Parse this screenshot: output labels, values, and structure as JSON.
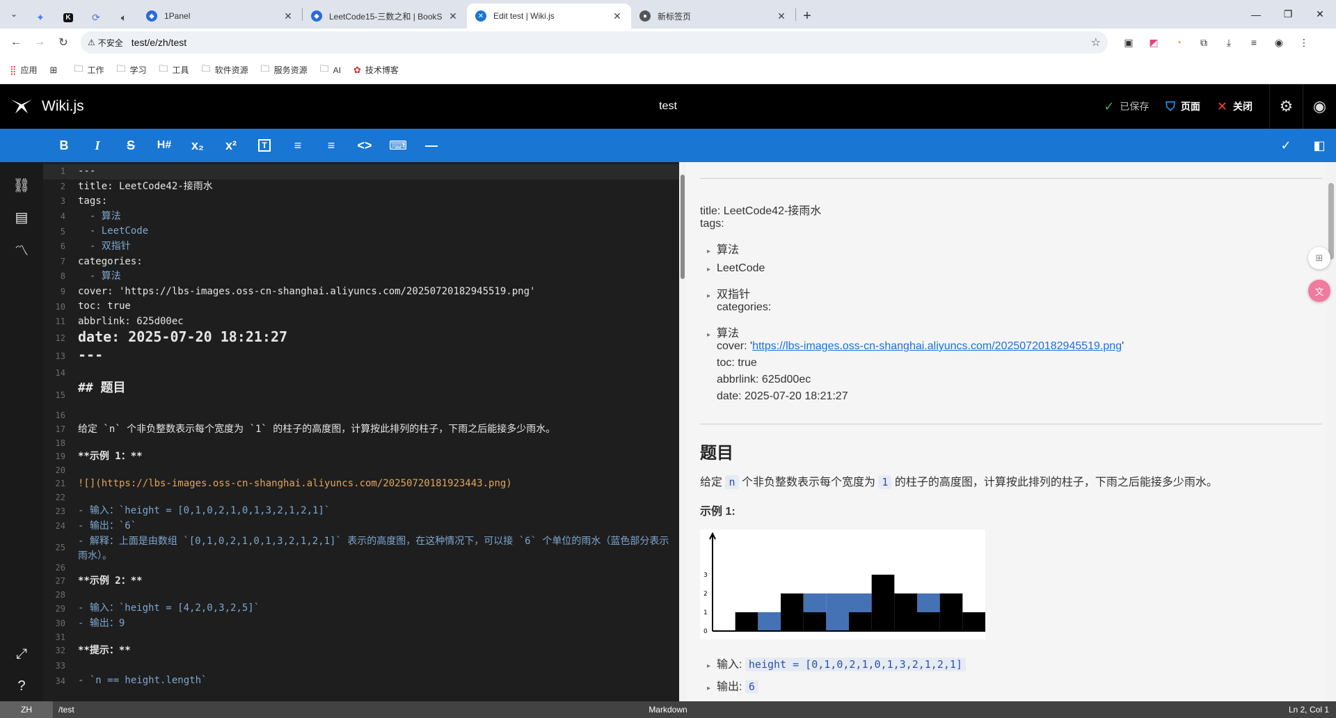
{
  "browser": {
    "tabs": [
      {
        "title": "1Panel",
        "active": false
      },
      {
        "title": "LeetCode15-三数之和 | BookS",
        "active": false
      },
      {
        "title": "Edit test | Wiki.js",
        "active": true
      },
      {
        "title": "新标签页",
        "active": false
      }
    ],
    "close_glyph": "✕",
    "new_tab_glyph": "+",
    "address": {
      "security_label": "不安全",
      "url": "test/e/zh/test"
    },
    "bookmarks": [
      "应用",
      "工作",
      "学习",
      "工具",
      "软件资源",
      "服务资源",
      "AI",
      "技术博客"
    ]
  },
  "app": {
    "brand": "Wiki.js",
    "page_title": "test",
    "actions": {
      "saved": "已保存",
      "page": "页面",
      "close": "关闭"
    }
  },
  "toolbar": {
    "icons": [
      "bold-icon",
      "italic-icon",
      "strikethrough-icon",
      "heading-icon",
      "subscript-icon",
      "superscript-icon",
      "blockquote-icon",
      "bullet-list-icon",
      "numbered-list-icon",
      "inline-code-icon",
      "keyboard-icon",
      "horizontal-rule-icon"
    ],
    "labels": [
      "B",
      "I",
      "S",
      "H#",
      "x₂",
      "x²",
      "T",
      "≡",
      "≡",
      "<>",
      "⌨",
      "—"
    ]
  },
  "editor": {
    "lines": [
      {
        "n": "1",
        "text": "---"
      },
      {
        "n": "2",
        "text": "title: LeetCode42-接雨水"
      },
      {
        "n": "3",
        "text": "tags:"
      },
      {
        "n": "4",
        "text": "  - 算法"
      },
      {
        "n": "5",
        "text": "  - LeetCode"
      },
      {
        "n": "6",
        "text": "  - 双指针"
      },
      {
        "n": "7",
        "text": "categories:"
      },
      {
        "n": "8",
        "text": "  - 算法"
      },
      {
        "n": "9",
        "text": "cover: 'https://lbs-images.oss-cn-shanghai.aliyuncs.com/20250720182945519.png'"
      },
      {
        "n": "10",
        "text": "toc: true"
      },
      {
        "n": "11",
        "text": "abbrlink: 625d00ec"
      },
      {
        "n": "12",
        "text": "date: 2025-07-20 18:21:27"
      },
      {
        "n": "13",
        "text": "---"
      },
      {
        "n": "14",
        "text": ""
      },
      {
        "n": "15",
        "text": "## 题目"
      },
      {
        "n": "16",
        "text": ""
      },
      {
        "n": "17",
        "text": "给定 `n` 个非负整数表示每个宽度为 `1` 的柱子的高度图，计算按此排列的柱子，下雨之后能接多少雨水。"
      },
      {
        "n": "18",
        "text": ""
      },
      {
        "n": "19",
        "text": "**示例 1：**"
      },
      {
        "n": "20",
        "text": ""
      },
      {
        "n": "21",
        "text": "![](https://lbs-images.oss-cn-shanghai.aliyuncs.com/20250720181923443.png)"
      },
      {
        "n": "22",
        "text": ""
      },
      {
        "n": "23",
        "text": "- 输入：`height = [0,1,0,2,1,0,1,3,2,1,2,1]`"
      },
      {
        "n": "24",
        "text": "- 输出：`6`"
      },
      {
        "n": "25",
        "text": "- 解释：上面是由数组 `[0,1,0,2,1,0,1,3,2,1,2,1]` 表示的高度图，在这种情况下，可以接 `6` 个单位的雨水（蓝色部分表示雨水）。"
      },
      {
        "n": "26",
        "text": ""
      },
      {
        "n": "27",
        "text": "**示例 2：**"
      },
      {
        "n": "28",
        "text": ""
      },
      {
        "n": "29",
        "text": "- 输入：`height = [4,2,0,3,2,5]`"
      },
      {
        "n": "30",
        "text": "- 输出：9"
      },
      {
        "n": "31",
        "text": ""
      },
      {
        "n": "32",
        "text": "**提示：**"
      },
      {
        "n": "33",
        "text": ""
      },
      {
        "n": "34",
        "text": "- `n == height.length`"
      }
    ]
  },
  "preview": {
    "front_title": "title: LeetCode42-接雨水",
    "front_tags": "tags:",
    "tags": [
      "算法",
      "LeetCode",
      "双指针"
    ],
    "categories_label": "categories:",
    "category": "算法",
    "cover_label": "cover: '",
    "cover_url": "https://lbs-images.oss-cn-shanghai.aliyuncs.com/20250720182945519.png",
    "cover_end": "'",
    "toc": "toc: true",
    "abbrlink": "abbrlink: 625d00ec",
    "date": "date: 2025-07-20 18:21:27",
    "heading": "题目",
    "desc_1": "给定",
    "desc_n": "n",
    "desc_2": "个非负整数表示每个宽度为",
    "desc_1v": "1",
    "desc_3": "的柱子的高度图，计算按此排列的柱子，下雨之后能接多少雨水。",
    "example1": "示例 1:",
    "input_label": "输入:",
    "input_code": "height = [0,1,0,2,1,0,1,3,2,1,2,1]",
    "output_label": "输出:",
    "output_code": "6",
    "chart_axis_labels": [
      "0",
      "1",
      "2",
      "3"
    ]
  },
  "statusbar": {
    "lang": "ZH",
    "path": "/test",
    "mode": "Markdown",
    "position": "Ln 2, Col 1"
  },
  "colors": {
    "toolbar": "#1976d2",
    "header": "#000000",
    "water": "#4472b4",
    "bar": "#000000"
  }
}
